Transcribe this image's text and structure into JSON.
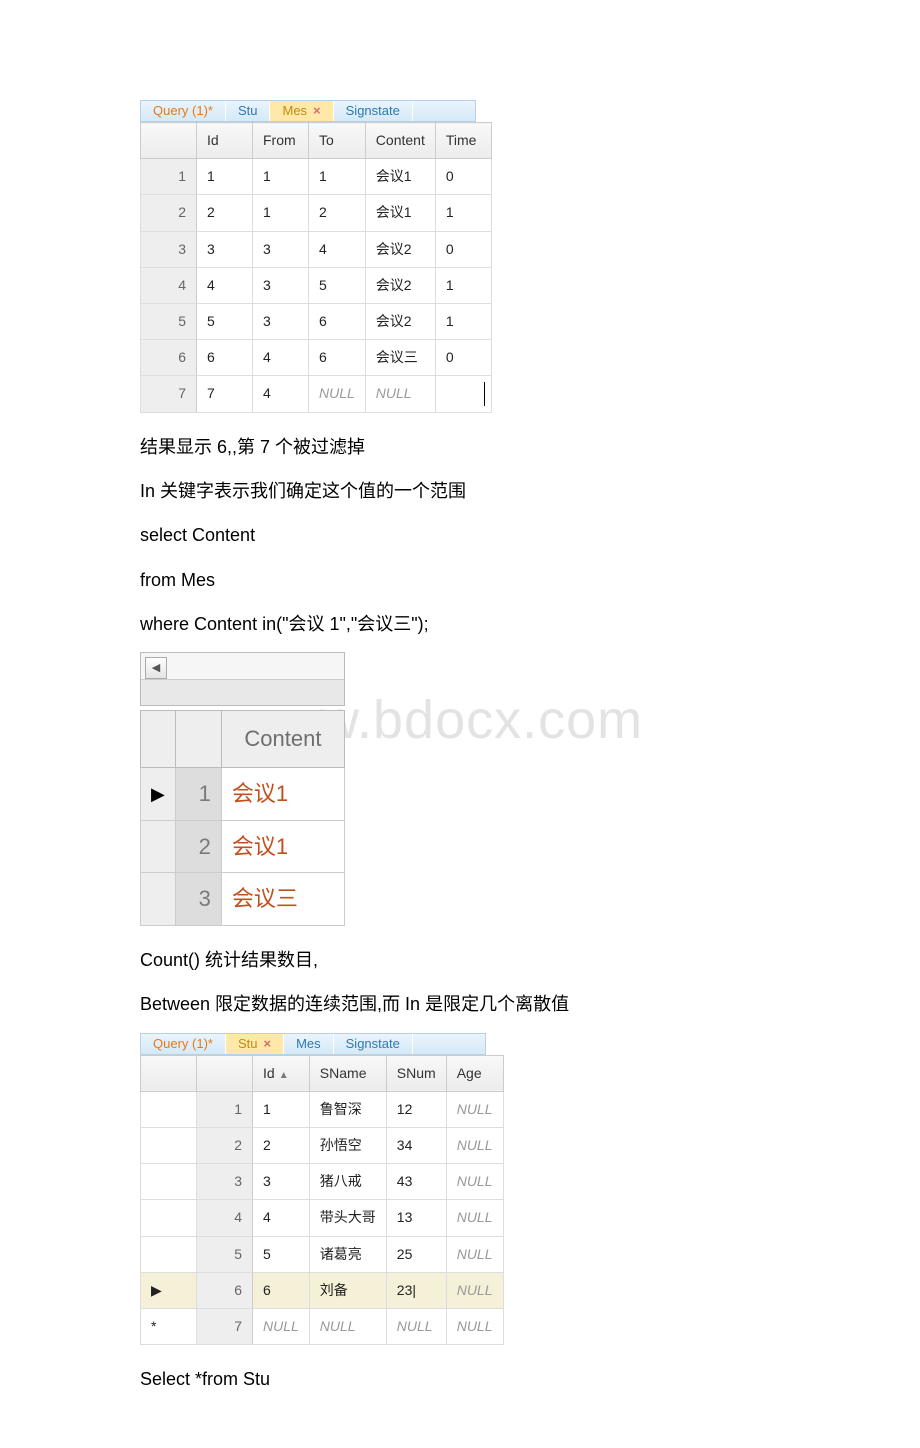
{
  "table1": {
    "tabs": [
      {
        "label": "Query (1)*",
        "variant": "orange"
      },
      {
        "label": "Stu",
        "variant": "blue"
      },
      {
        "label": "Mes",
        "variant": "active",
        "close": "×"
      },
      {
        "label": "Signstate",
        "variant": "blue"
      }
    ],
    "headers": [
      "Id",
      "From",
      "To",
      "Content",
      "Time"
    ],
    "rows": [
      {
        "n": "1",
        "Id": "1",
        "From": "1",
        "To": "1",
        "Content": "会议1",
        "Time": "0"
      },
      {
        "n": "2",
        "Id": "2",
        "From": "1",
        "To": "2",
        "Content": "会议1",
        "Time": "1"
      },
      {
        "n": "3",
        "Id": "3",
        "From": "3",
        "To": "4",
        "Content": "会议2",
        "Time": "0"
      },
      {
        "n": "4",
        "Id": "4",
        "From": "3",
        "To": "5",
        "Content": "会议2",
        "Time": "1"
      },
      {
        "n": "5",
        "Id": "5",
        "From": "3",
        "To": "6",
        "Content": "会议2",
        "Time": "1"
      },
      {
        "n": "6",
        "Id": "6",
        "From": "4",
        "To": "6",
        "Content": "会议三",
        "Time": "0"
      },
      {
        "n": "7",
        "Id": "7",
        "From": "4",
        "To": "NULL",
        "Content": "NULL",
        "Time": ""
      }
    ]
  },
  "para1": "结果显示 6,,第 7 个被过滤掉",
  "para2": "In 关键字表示我们确定这个值的一个范围",
  "para3": "select Content",
  "para4": "from Mes",
  "para5": "where Content in(\"会议 1\",\"会议三\");",
  "watermark": "w.bdocx.com",
  "table2": {
    "header": "Content",
    "rows": [
      {
        "n": "1",
        "v": "会议1",
        "cur": "▶"
      },
      {
        "n": "2",
        "v": "会议1",
        "cur": ""
      },
      {
        "n": "3",
        "v": "会议三",
        "cur": ""
      }
    ]
  },
  "para6": " Count() 统计结果数目,",
  "para7": "Between 限定数据的连续范围,而 In 是限定几个离散值",
  "table3": {
    "tabs": [
      {
        "label": "Query (1)*",
        "variant": "orange"
      },
      {
        "label": "Stu",
        "variant": "active",
        "close": "×"
      },
      {
        "label": "Mes",
        "variant": "blue"
      },
      {
        "label": "Signstate",
        "variant": "blue"
      }
    ],
    "headers": [
      "Id",
      "SName",
      "SNum",
      "Age"
    ],
    "rows": [
      {
        "m": "",
        "n": "1",
        "Id": "1",
        "SName": "鲁智深",
        "SNum": "12",
        "Age": "NULL"
      },
      {
        "m": "",
        "n": "2",
        "Id": "2",
        "SName": "孙悟空",
        "SNum": "34",
        "Age": "NULL"
      },
      {
        "m": "",
        "n": "3",
        "Id": "3",
        "SName": "猪八戒",
        "SNum": "43",
        "Age": "NULL"
      },
      {
        "m": "",
        "n": "4",
        "Id": "4",
        "SName": "带头大哥",
        "SNum": "13",
        "Age": "NULL"
      },
      {
        "m": "",
        "n": "5",
        "Id": "5",
        "SName": "诸葛亮",
        "SNum": "25",
        "Age": "NULL"
      },
      {
        "m": "▶",
        "n": "6",
        "Id": "6",
        "SName": "刘备",
        "SNum": "23|",
        "Age": "NULL"
      },
      {
        "m": "*",
        "n": "7",
        "Id": "NULL",
        "SName": "NULL",
        "SNum": "NULL",
        "Age": "NULL"
      }
    ]
  },
  "para8": "Select *from Stu"
}
